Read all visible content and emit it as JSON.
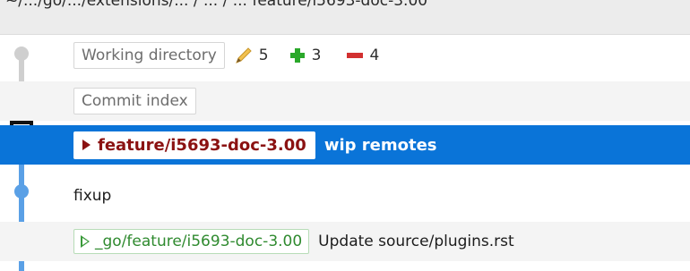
{
  "topbar": {
    "path_text": "~/.../go/.../extensions/... / ... / ...   feature/i5693-doc-3.00"
  },
  "commits": [
    {
      "chip": "Working directory",
      "stats": {
        "modified": "5",
        "added": "3",
        "removed": "4"
      }
    },
    {
      "chip": "Commit index"
    },
    {
      "branch": "feature/i5693-doc-3.00",
      "message": "wip remotes",
      "selected": true
    },
    {
      "message": "fixup"
    },
    {
      "remote_branch": "_go/feature/i5693-doc-3.00",
      "message": "Update source/plugins.rst"
    }
  ],
  "icons": [
    "pencil-icon",
    "plus-icon",
    "minus-icon",
    "branch-triangle-icon",
    "remote-triangle-icon"
  ],
  "colors": {
    "selected_row": "#0a74d8",
    "graph_gray": "#cfcfcf",
    "graph_blue": "#5aa0e6",
    "branch_text": "#8b1212",
    "remote_text": "#2f8a2f",
    "plus_green": "#2aa82a",
    "minus_red": "#d23030"
  }
}
